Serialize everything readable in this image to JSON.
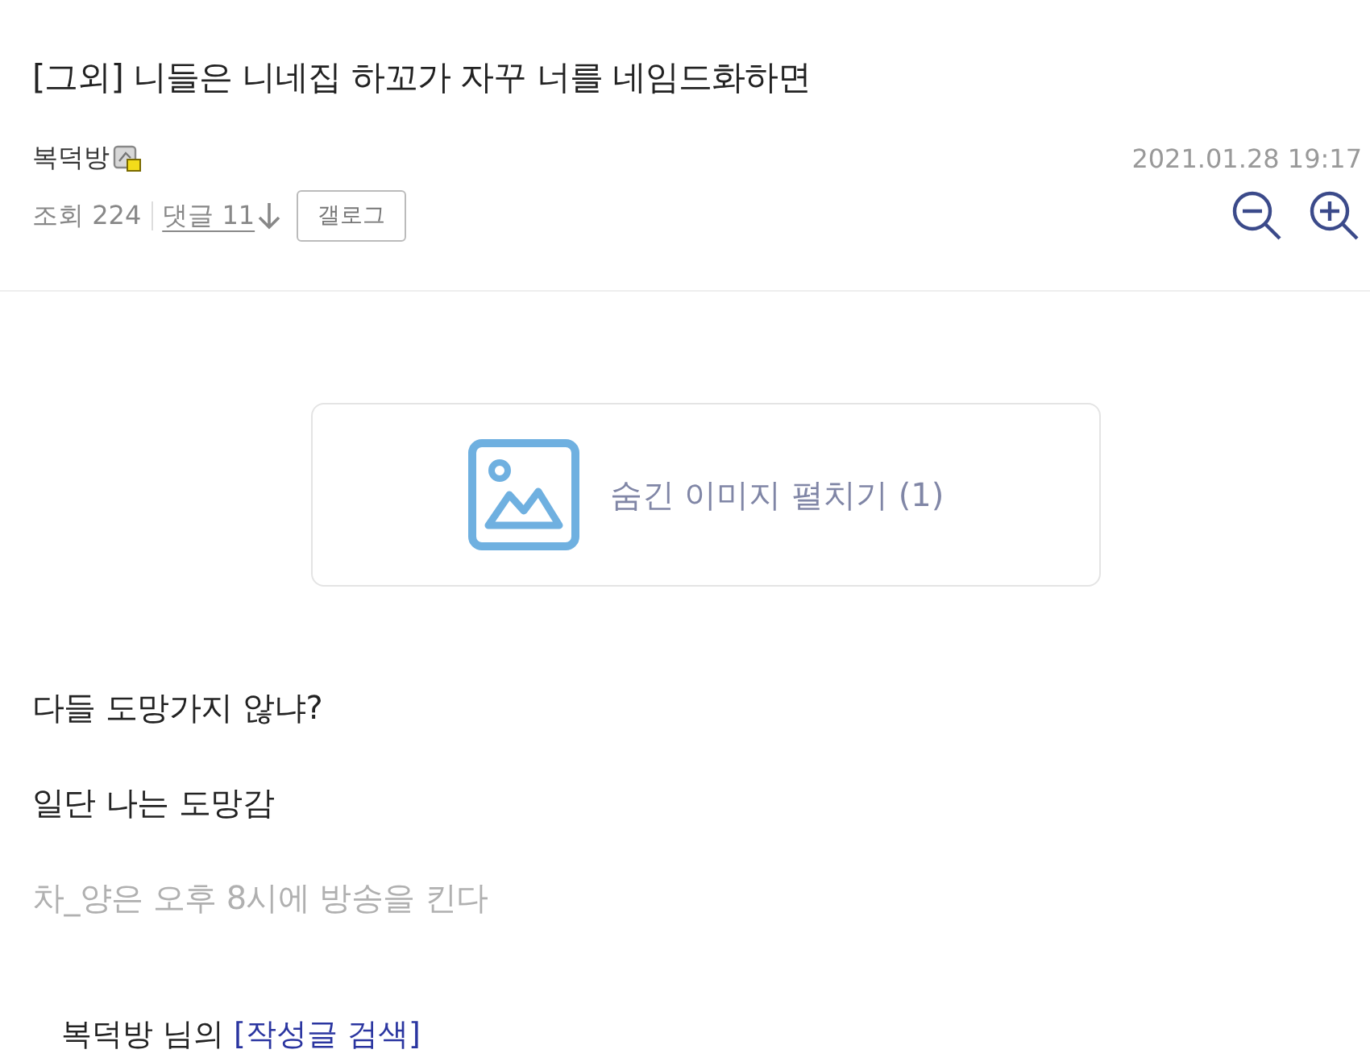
{
  "post": {
    "title": "[그외] 니들은 니네집 하꼬가 자꾸 너를 네임드화하면",
    "author": "복덕방",
    "datetime": "2021.01.28 19:17",
    "views": "조회 224",
    "comments": "댓글 11",
    "gallog_button": "갤로그"
  },
  "hidden_image": {
    "label": "숨긴 이미지 펼치기 (1)"
  },
  "paragraphs": [
    {
      "kind": "normal",
      "text": "다들 도망가지 않냐?"
    },
    {
      "kind": "normal",
      "text": "일단 나는 도망감"
    },
    {
      "kind": "muted",
      "text": "차_양은 오후 8시에 방송을 킨다"
    }
  ],
  "footer": {
    "prefix": "복덕방 님의",
    "link": "[작성글 검색]"
  }
}
